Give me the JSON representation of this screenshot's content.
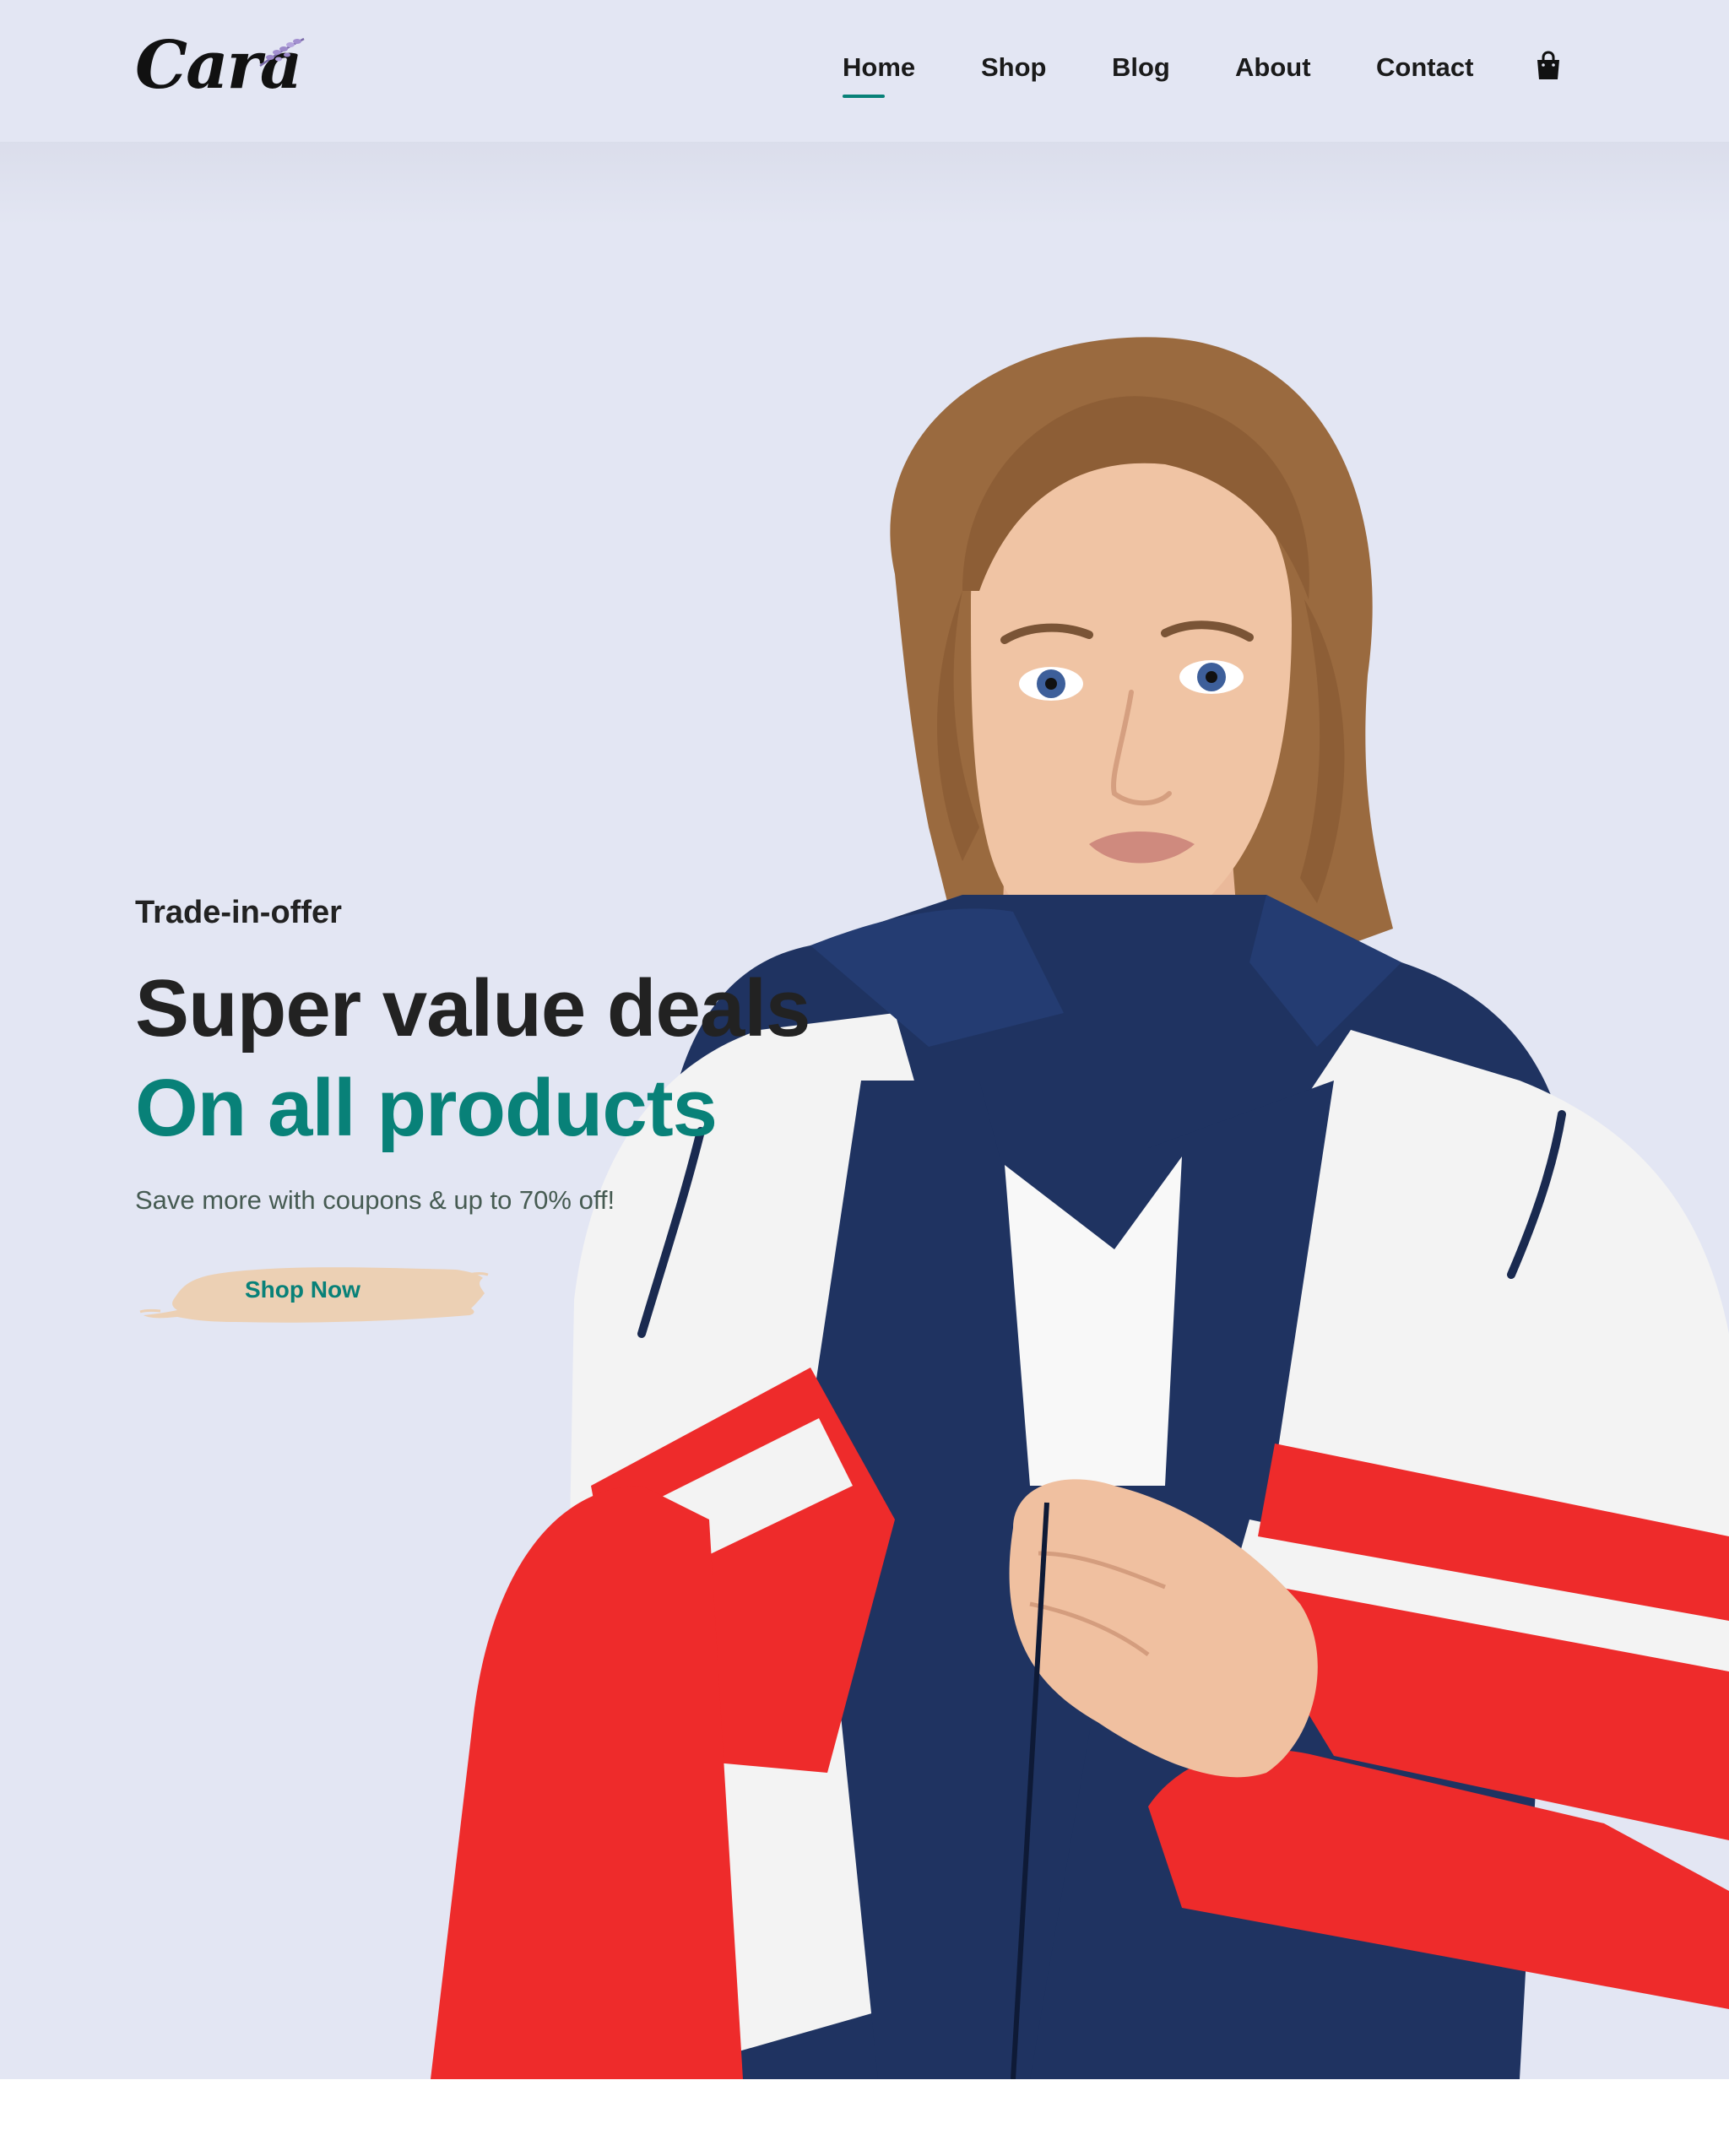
{
  "brand": {
    "logo_text": "Cara"
  },
  "nav": {
    "items": [
      {
        "label": "Home",
        "active": true
      },
      {
        "label": "Shop"
      },
      {
        "label": "Blog"
      },
      {
        "label": "About"
      },
      {
        "label": "Contact"
      }
    ],
    "cart_icon": "shopping-bag-icon"
  },
  "hero": {
    "eyebrow": "Trade-in-offer",
    "headline": "Super value deals",
    "highlight": "On all products",
    "subtext": "Save more with coupons & up to 70% off!",
    "cta_label": "Shop Now"
  },
  "colors": {
    "hero_background": "#e3e6f3",
    "accent": "#088178",
    "button_brush": "#ecd0b4",
    "jacket_navy": "#1f3361",
    "jacket_red": "#ee2b2b",
    "jacket_white": "#f3f3f3"
  }
}
